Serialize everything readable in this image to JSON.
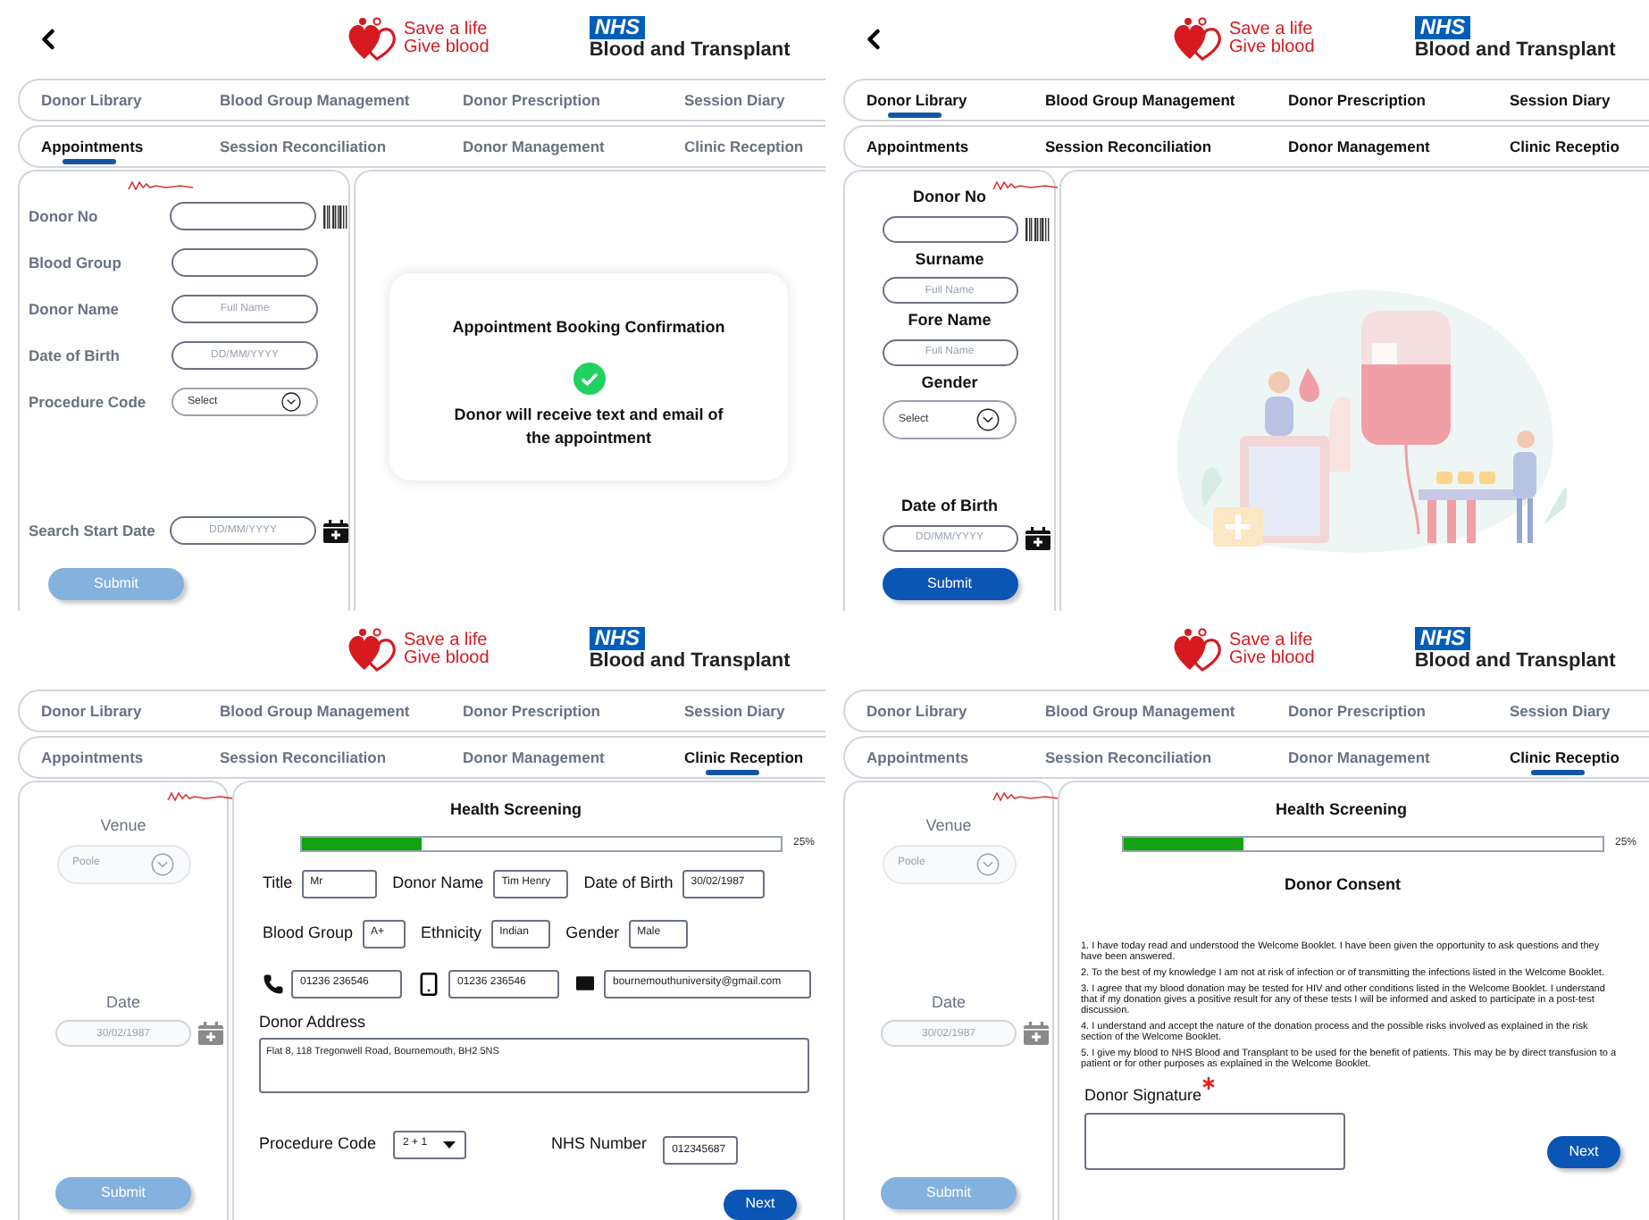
{
  "screens": [
    {
      "back_button": true,
      "header": {
        "slogan_line_1": "Save a life",
        "slogan_line_2": "Give blood",
        "badge": "NHS",
        "org_name": "Blood and Transplant"
      },
      "tabs": [
        [
          {
            "label": "Donor Library",
            "selected": false,
            "dimmed": true
          },
          {
            "label": "Blood Group Management",
            "selected": false,
            "dimmed": true
          },
          {
            "label": "Donor Prescription",
            "selected": false,
            "dimmed": true
          },
          {
            "label": "Session Diary",
            "selected": false,
            "dimmed": true
          }
        ],
        [
          {
            "label": "Appointments",
            "selected": true,
            "dimmed": false
          },
          {
            "label": "Session Reconciliation",
            "selected": false,
            "dimmed": true
          },
          {
            "label": "Donor Management",
            "selected": false,
            "dimmed": true
          },
          {
            "label": "Clinic Reception",
            "selected": false,
            "dimmed": true
          }
        ]
      ],
      "form": {
        "kind": "inline",
        "fields": [
          {
            "label": "Donor No",
            "kind": "scan",
            "disabled": false
          },
          {
            "label": "Blood Group",
            "kind": "text",
            "disabled": false
          },
          {
            "label": "Donor Name",
            "kind": "text",
            "placeholder": "Full Name",
            "disabled": false
          },
          {
            "label": "Date of Birth",
            "kind": "text",
            "placeholder": "DD/MM/YYYY",
            "disabled": false
          },
          {
            "label": "Procedure Code",
            "kind": "select",
            "placeholder": "Select",
            "disabled": false
          },
          {
            "label": "Search Start Date",
            "kind": "date",
            "placeholder": "DD/MM/YYYY",
            "disabled": false
          }
        ],
        "submit": {
          "label": "Submit",
          "disabled": true
        }
      },
      "main": {
        "kind": "confirmation",
        "title": "Appointment Booking Confirmation",
        "message": "Donor will receive text and email of the appointment"
      }
    },
    {
      "back_button": true,
      "header": {
        "slogan_line_1": "Save a life",
        "slogan_line_2": "Give blood",
        "badge": "NHS",
        "org_name": "Blood and Transplant"
      },
      "tabs": [
        [
          {
            "label": "Donor Library",
            "selected": true,
            "dimmed": false
          },
          {
            "label": "Blood Group Management",
            "selected": false,
            "dimmed": false
          },
          {
            "label": "Donor Prescription",
            "selected": false,
            "dimmed": false
          },
          {
            "label": "Session Diary",
            "selected": false,
            "dimmed": false
          }
        ],
        [
          {
            "label": "Appointments",
            "selected": false,
            "dimmed": false
          },
          {
            "label": "Session Reconciliation",
            "selected": false,
            "dimmed": false
          },
          {
            "label": "Donor Management",
            "selected": false,
            "dimmed": false
          },
          {
            "label": "Clinic Receptio",
            "selected": false,
            "dimmed": false
          }
        ]
      ],
      "form": {
        "kind": "stacked",
        "fields": [
          {
            "label": "Donor No",
            "kind": "scan",
            "disabled": false
          },
          {
            "label": "Surname",
            "kind": "text",
            "placeholder": "Full Name",
            "disabled": false
          },
          {
            "label": "Fore Name",
            "kind": "text",
            "placeholder": "Full Name",
            "disabled": false
          },
          {
            "label": "Gender",
            "kind": "select",
            "placeholder": "Select",
            "disabled": false
          },
          {
            "label": "Date of Birth",
            "kind": "date",
            "placeholder": "DD/MM/YYYY",
            "disabled": false
          }
        ],
        "submit": {
          "label": "Submit",
          "disabled": false
        }
      },
      "main": {
        "kind": "illustration"
      }
    },
    {
      "header": {
        "slogan_line_1": "Save a life",
        "slogan_line_2": "Give blood",
        "badge": "NHS",
        "org_name": "Blood and Transplant"
      },
      "tabs": [
        [
          {
            "label": "Donor Library",
            "selected": false,
            "dimmed": true
          },
          {
            "label": "Blood Group Management",
            "selected": false,
            "dimmed": true
          },
          {
            "label": "Donor Prescription",
            "selected": false,
            "dimmed": true
          },
          {
            "label": "Session Diary",
            "selected": false,
            "dimmed": true
          }
        ],
        [
          {
            "label": "Appointments",
            "selected": false,
            "dimmed": true
          },
          {
            "label": "Session Reconciliation",
            "selected": false,
            "dimmed": true
          },
          {
            "label": "Donor Management",
            "selected": false,
            "dimmed": true
          },
          {
            "label": "Clinic Reception",
            "selected": true,
            "dimmed": false
          }
        ]
      ],
      "form": {
        "kind": "spread",
        "fields": [
          {
            "label": "Venue",
            "kind": "select",
            "value": "Poole",
            "disabled": true
          },
          {
            "label": "Date",
            "kind": "date",
            "value": "30/02/1987",
            "disabled": true
          }
        ],
        "submit": {
          "label": "Submit",
          "disabled": true
        }
      },
      "main": {
        "kind": "screening",
        "title": "Health Screening",
        "progress": {
          "level": 0.25,
          "reading": "25%"
        },
        "rows": [
          [
            {
              "label": "Title",
              "value": "Mr"
            },
            {
              "label": "Donor Name",
              "value": "Tim Henry"
            },
            {
              "label": "Date of Birth",
              "value": "30/02/1987"
            }
          ],
          [
            {
              "label": "Blood Group",
              "value": "A+"
            },
            {
              "label": "Ethnicity",
              "value": "Indian"
            },
            {
              "label": "Gender",
              "value": "Male"
            }
          ]
        ],
        "contacts": [
          {
            "kind": "phone",
            "value": "01236 236546"
          },
          {
            "kind": "mobile",
            "value": "01236 236546"
          },
          {
            "kind": "email",
            "value": "bournemouthuniversity@gmail.com"
          }
        ],
        "address": {
          "label": "Donor Address",
          "value": "Flat 8, 118 Tregonwell Road, Bournemouth, BH2 5NS"
        },
        "procedure_code": {
          "label": "Procedure Code",
          "value": "2 + 1"
        },
        "nhs_number": {
          "label": "NHS Number",
          "value": "012345687"
        },
        "next": "Next"
      }
    },
    {
      "header": {
        "slogan_line_1": "Save a life",
        "slogan_line_2": "Give blood",
        "badge": "NHS",
        "org_name": "Blood and Transplant"
      },
      "tabs": [
        [
          {
            "label": "Donor Library",
            "selected": false,
            "dimmed": true
          },
          {
            "label": "Blood Group Management",
            "selected": false,
            "dimmed": true
          },
          {
            "label": "Donor Prescription",
            "selected": false,
            "dimmed": true
          },
          {
            "label": "Session Diary",
            "selected": false,
            "dimmed": true
          }
        ],
        [
          {
            "label": "Appointments",
            "selected": false,
            "dimmed": true
          },
          {
            "label": "Session Reconciliation",
            "selected": false,
            "dimmed": true
          },
          {
            "label": "Donor Management",
            "selected": false,
            "dimmed": true
          },
          {
            "label": "Clinic Receptio",
            "selected": true,
            "dimmed": false
          }
        ]
      ],
      "form": {
        "kind": "spread",
        "fields": [
          {
            "label": "Venue",
            "kind": "select",
            "value": "Poole",
            "disabled": true
          },
          {
            "label": "Date",
            "kind": "date",
            "value": "30/02/1987",
            "disabled": true
          }
        ],
        "submit": {
          "label": "Submit",
          "disabled": true
        }
      },
      "main": {
        "kind": "consent",
        "title": "Health Screening",
        "progress": {
          "level": 0.25,
          "reading": "25%"
        },
        "subtitle": "Donor Consent",
        "items": [
          "1. I have today read and understood the Welcome Booklet. I have been given the opportunity to ask questions and they have been answered.",
          "2. To the best of my knowledge I am not at risk of infection or of transmitting the infections listed in the Welcome Booklet.",
          "3. I agree that my blood donation may be tested for HIV and other conditions listed in the Welcome Booklet. I understand that if my donation gives a positive result for any of these tests I will be informed and asked to participate in a post-test discussion.",
          "4. I understand and accept the nature of the donation process and the possible risks involved as explained in the risk section of the Welcome Booklet.",
          "5. I give my blood to NHS Blood and Transplant to be used for the benefit of patients. This may be by direct transfusion to a patient or for other purposes as explained in the Welcome Booklet."
        ],
        "signature": {
          "label": "Donor Signature",
          "required": true
        },
        "next": "Next"
      }
    }
  ]
}
